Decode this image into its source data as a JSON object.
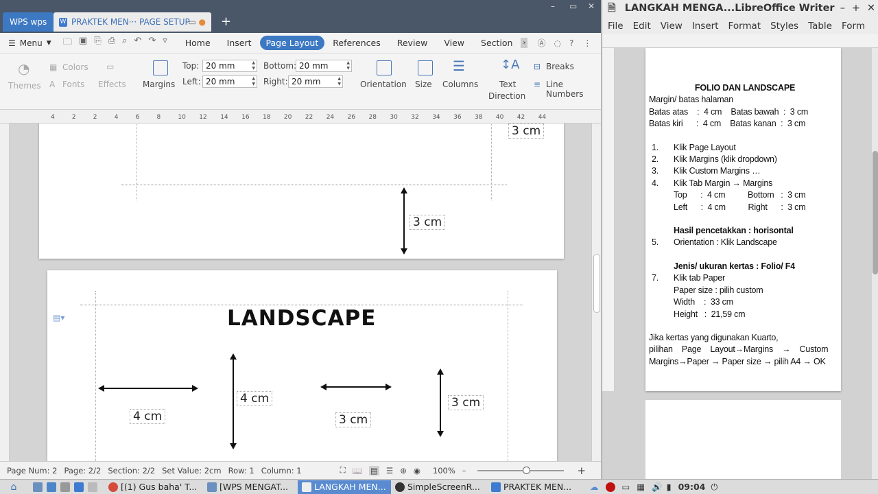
{
  "wps": {
    "home_tab": "WPS wps",
    "doc_tab": "PRAKTEK MEN··· PAGE SETUP",
    "menu_label": "Menu",
    "tabs": [
      "Home",
      "Insert",
      "Page Layout",
      "References",
      "Review",
      "View",
      "Section"
    ],
    "ribbon": {
      "themes": "Themes",
      "colors": "Colors",
      "fonts": "Fonts",
      "effects": "Effects",
      "margins": "Margins",
      "top_label": "Top:",
      "top_value": "20 mm",
      "bottom_label": "Bottom:",
      "bottom_value": "20 mm",
      "left_label": "Left:",
      "left_value": "20 mm",
      "right_label": "Right:",
      "right_value": "20 mm",
      "orientation": "Orientation",
      "size": "Size",
      "columns": "Columns",
      "text_direction_1": "Text",
      "text_direction_2": "Direction",
      "breaks": "Breaks",
      "line_numbers": "Line Numbers"
    },
    "ruler_ticks": [
      "4",
      "2",
      "2",
      "4",
      "6",
      "8",
      "10",
      "12",
      "14",
      "16",
      "18",
      "20",
      "22",
      "24",
      "26",
      "28",
      "30",
      "32",
      "34",
      "36",
      "38",
      "40",
      "42",
      "44"
    ],
    "page1_labels": [
      "3 cm",
      "3 cm"
    ],
    "page2": {
      "heading": "LANDSCAPE",
      "labels": [
        "4 cm",
        "4 cm",
        "3 cm",
        "3 cm"
      ]
    },
    "status": {
      "page_num": "Page Num: 2",
      "page": "Page: 2/2",
      "section": "Section: 2/2",
      "set_value": "Set Value: 2cm",
      "row": "Row: 1",
      "column": "Column: 1",
      "zoom": "100%"
    }
  },
  "lo": {
    "title": "LANGKAH MENGA...LibreOffice Writer",
    "menu": [
      "File",
      "Edit",
      "View",
      "Insert",
      "Format",
      "Styles",
      "Table",
      "Form"
    ],
    "doc": {
      "heading": "FOLIO DAN LANDSCAPE",
      "l1": "Margin/ batas halaman",
      "l2": "Batas atas    :  4 cm    Batas bawah  :  3 cm",
      "l3": "Batas kiri      :  4 cm    Batas kanan  :  3 cm",
      "s1": "Klik Page Layout",
      "s2": "Klik Margins (klik dropdown)",
      "s3": "Klik Custom Margins …",
      "s4": "Klik Tab Margin → Margins",
      "s4a": "Top      :  4 cm          Bottom   :  3 cm",
      "s4b": "Left      :  4 cm          Right      :  3 cm",
      "h1": "Hasil pencetakkan  : horisontal",
      "s5": "Orientation : Klik Landscape",
      "h2": "Jenis/ ukuran kertas : Folio/ F4",
      "s7": "Klik tab Paper",
      "s7a": "Paper size :  pilih custom",
      "s7b": "Width    :  33 cm",
      "s7c": "Height   :  21,59 cm",
      "p1": "Jika kertas yang digunakan  Kuarto,",
      "p2": "pilihan    Page    Layout→Margins    →    Custom",
      "p3": "Margins→Paper → Paper size → pilih A4 → OK",
      "nums": [
        "1.",
        "2.",
        "3.",
        "4.",
        "5.",
        "7."
      ]
    }
  },
  "taskbar": {
    "items": [
      "[(1) Gus baha' T...",
      "[WPS MENGAT...",
      "LANGKAH MEN...",
      "SimpleScreenR...",
      "PRAKTEK MEN..."
    ],
    "clock": "09:04"
  }
}
